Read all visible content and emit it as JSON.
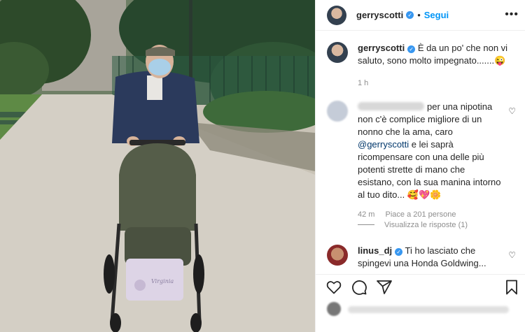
{
  "post": {
    "username": "gerryscotti",
    "follow_label": "Segui",
    "dot": "•",
    "more": "•••"
  },
  "caption": {
    "username": "gerryscotti",
    "text": "È da un po' che non vi saluto, sono molto impegnato.......😜",
    "time": "1 h"
  },
  "comments": [
    {
      "text_before": "per una nipotina non c'è complice migliore di un nonno che la ama, caro ",
      "mention": "@gerryscotti",
      "text_after": " e lei saprà ricompensare con una delle più potenti strette di mano che esistano, con la sua manina intorno al tuo dito... 🥰💖🌼",
      "time": "42 m",
      "likes": "Piace a 201 persone",
      "replies": "Visualizza le risposte (1)"
    },
    {
      "username": "linus_dj",
      "text": "Ti ho lasciato che spingevi una Honda Goldwing..."
    }
  ],
  "photo": {
    "stroller_label": "Virginia"
  },
  "icons": {
    "verified": "✓",
    "heart": "♡"
  },
  "colors": {
    "link_blue": "#0095f6",
    "verified_blue": "#3897f0",
    "text": "#262626",
    "muted": "#8e8e8e"
  }
}
